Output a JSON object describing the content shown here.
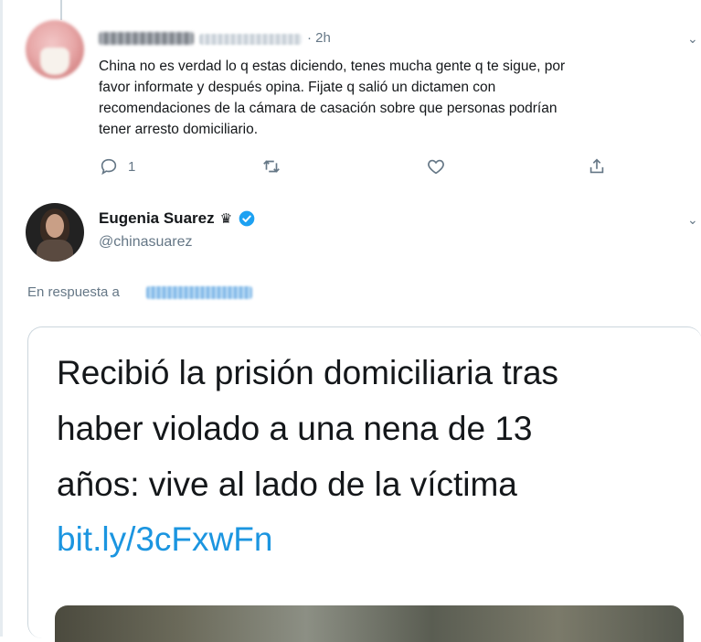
{
  "reply_tweet": {
    "time": "2h",
    "text_lines": [
      "China no es verdad lo q estas diciendo,  tenes mucha gente q te sigue, por",
      "favor informate y después opina. Fijate q salió un dictamen con",
      "recomendaciones de la cámara de casación sobre que personas podrían",
      "tener arresto domiciliario."
    ],
    "actions": {
      "reply_count": "1"
    }
  },
  "main_tweet": {
    "name": "Eugenia Suarez",
    "handle": "@chinasuarez",
    "reply_prefix": "En respuesta a",
    "card": {
      "headline_lines": [
        "Recibió la prisión domiciliaria tras",
        "haber violado a una nena de 13",
        "años: vive al lado de la víctima"
      ],
      "link": "bit.ly/3cFxwFn"
    }
  },
  "colors": {
    "link_blue": "#1b95e0",
    "muted_gray": "#657786",
    "verified_blue": "#1da1f2"
  }
}
